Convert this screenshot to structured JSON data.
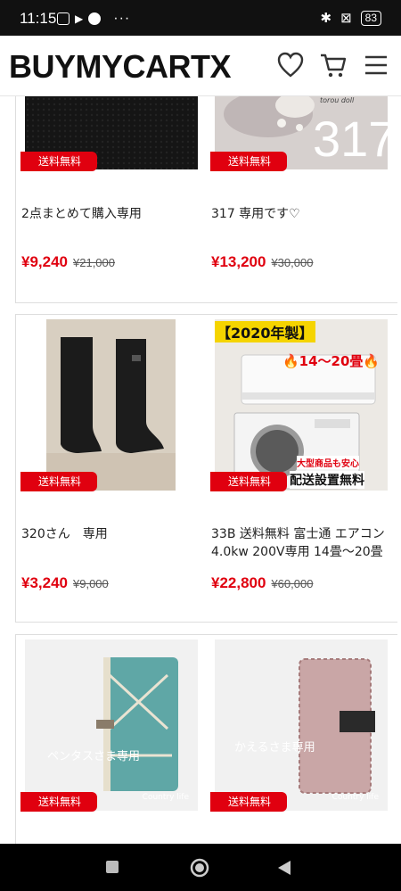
{
  "statusbar": {
    "time": "11:15",
    "battery": "83"
  },
  "header": {
    "logo": "BUYMYCARTX"
  },
  "products": [
    {
      "title": "2点まとめて購入専用",
      "price": "¥9,240",
      "original": "¥21,000",
      "badge": "送料無料"
    },
    {
      "title": "317 専用です♡",
      "price": "¥13,200",
      "original": "¥30,000",
      "badge": "送料無料",
      "image_text": "317",
      "image_caption": "torou doll"
    },
    {
      "title": "320さん　専用",
      "price": "¥3,240",
      "original": "¥9,000",
      "badge": "送料無料"
    },
    {
      "title": "33B 送料無料 富士通 エアコン 4.0kw 200V専用 14畳〜20畳",
      "price": "¥22,800",
      "original": "¥60,000",
      "badge": "送料無料",
      "image_top": "【2020年製】",
      "image_sub": "🔥14〜20畳🔥",
      "image_note": "大型商品も安心",
      "image_bottom": "配送設置無料"
    },
    {
      "title": "",
      "price": "",
      "original": "",
      "badge": "送料無料",
      "image_text": "ペンタスさま専用",
      "image_caption": "Country life"
    },
    {
      "title": "",
      "price": "",
      "original": "",
      "badge": "送料無料",
      "image_text": "かえるさま専用",
      "image_caption": "Country life"
    }
  ],
  "colors": {
    "accent": "#e0000f",
    "text": "#222222"
  }
}
